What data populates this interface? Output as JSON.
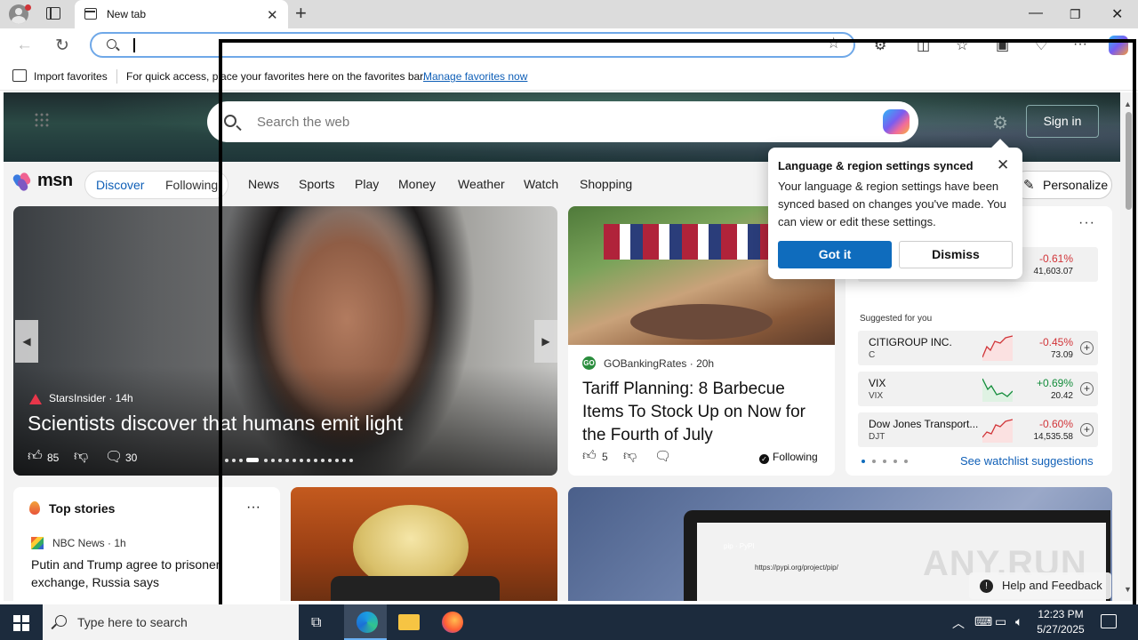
{
  "browser": {
    "tab_title": "New tab",
    "address_value": "",
    "favorites_bar": {
      "import_label": "Import favorites",
      "message": "For quick access, place your favorites here on the favorites bar.",
      "manage_link": "Manage favorites now"
    }
  },
  "msn": {
    "search_placeholder": "Search the web",
    "sign_in": "Sign in",
    "logo_text": "msn",
    "feed_tabs": [
      "Discover",
      "Following"
    ],
    "nav_items": [
      "News",
      "Sports",
      "Play",
      "Money",
      "Weather",
      "Watch",
      "Shopping"
    ],
    "personalize": "Personalize",
    "main_story": {
      "source": "StarsInsider",
      "age": "14h",
      "headline": "Scientists discover that humans emit light",
      "likes": "85",
      "comments": "30"
    },
    "card2": {
      "source": "GOBankingRates",
      "age": "20h",
      "headline": "Tariff Planning: 8 Barbecue Items To Stock Up on Now for the Fourth of July",
      "likes": "5",
      "following": "Following"
    },
    "watchlist": {
      "first_row": {
        "change": "-0.61%",
        "price": "41,603.07"
      },
      "suggested_label": "Suggested for you",
      "items": [
        {
          "name": "CITIGROUP INC.",
          "ticker": "C",
          "change": "-0.45%",
          "price": "73.09",
          "direction": "down"
        },
        {
          "name": "VIX",
          "ticker": "VIX",
          "change": "+0.69%",
          "price": "20.42",
          "direction": "up"
        },
        {
          "name": "Dow Jones Transport...",
          "ticker": "DJT",
          "change": "-0.60%",
          "price": "14,535.58",
          "direction": "down"
        }
      ],
      "suggestions_link": "See watchlist suggestions"
    },
    "top_stories": {
      "title": "Top stories",
      "source": "NBC News",
      "age": "1h",
      "headline": "Putin and Trump agree to prisoner exchange, Russia says"
    },
    "laptop_card": {
      "url_text": "https://pypi.org/project/pip/",
      "tab_text": "pip · PyPI"
    },
    "help_feedback": "Help and Feedback",
    "watermark": "ANY.RUN"
  },
  "popup": {
    "title": "Language & region settings synced",
    "body": "Your language & region settings have been synced based on changes you've made. You can view or edit these settings.",
    "primary": "Got it",
    "secondary": "Dismiss"
  },
  "taskbar": {
    "search_placeholder": "Type here to search",
    "time": "12:23 PM",
    "date": "5/27/2025"
  },
  "colors": {
    "accent": "#0f6cbd",
    "link": "#0f5fb7",
    "negative": "#d13438",
    "positive": "#128c3a"
  }
}
